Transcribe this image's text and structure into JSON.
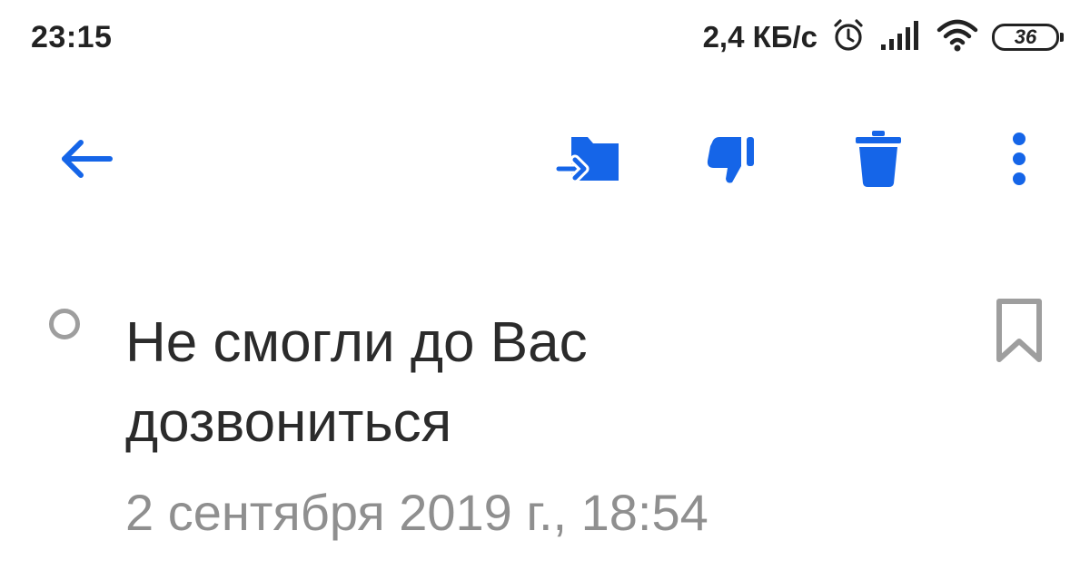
{
  "status_bar": {
    "time": "23:15",
    "net_speed": "2,4 КБ/с",
    "battery": "36",
    "icons": [
      "alarm-icon",
      "signal-icon",
      "wifi-icon",
      "battery-icon"
    ]
  },
  "toolbar": {
    "icons": [
      "back-arrow-icon",
      "move-to-folder-icon",
      "spam-thumbs-down-icon",
      "trash-icon",
      "more-vertical-icon"
    ],
    "accent_color": "#1565e8"
  },
  "message": {
    "subject": "Не смогли до Вас дозвониться",
    "date": "2 сентября 2019 г., 18:54",
    "subject_color": "#2b2b2b",
    "date_color": "#8f8f8f"
  }
}
